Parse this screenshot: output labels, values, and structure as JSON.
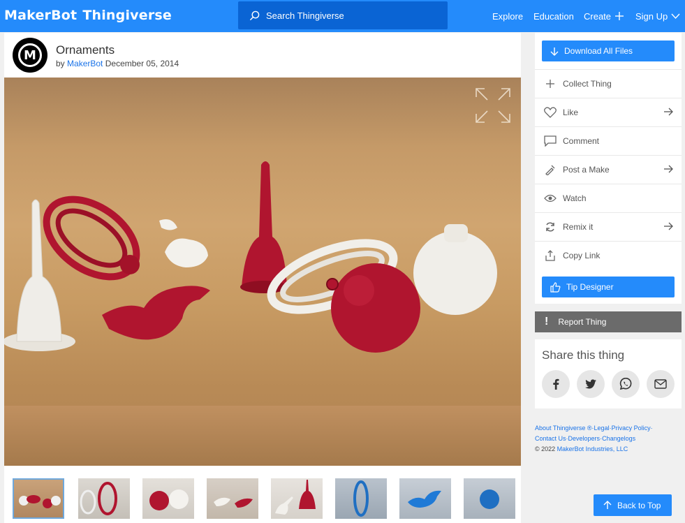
{
  "header": {
    "logo_makerbot": "MakerBot",
    "logo_thingiverse": "Thingiverse",
    "search_placeholder": "Search Thingiverse",
    "nav": {
      "explore": "Explore",
      "education": "Education",
      "create": "Create",
      "signup": "Sign Up"
    }
  },
  "thing": {
    "title": "Ornaments",
    "by_label": "by",
    "author": "MakerBot",
    "date": "December 05, 2014",
    "thumbnail_count": 8,
    "active_thumbnail": 1
  },
  "sidebar": {
    "download": "Download All Files",
    "collect": "Collect Thing",
    "like": "Like",
    "comment": "Comment",
    "post_make": "Post a Make",
    "watch": "Watch",
    "remix": "Remix it",
    "copy_link": "Copy Link",
    "tip": "Tip Designer",
    "report": "Report Thing"
  },
  "share": {
    "title": "Share this thing",
    "icons": [
      "facebook-icon",
      "twitter-icon",
      "whatsapp-icon",
      "email-icon"
    ]
  },
  "footer": {
    "about": "About Thingiverse",
    "reg": "®",
    "legal": "Legal",
    "privacy": "Privacy Policy",
    "contact": "Contact Us",
    "developers": "Developers",
    "changelogs": "Changelogs",
    "sep": "·",
    "copyright": "© 2022",
    "company": "MakerBot Industries, LLC"
  },
  "back_to_top": "Back to Top",
  "colors": {
    "brand_blue": "#248bfb",
    "search_blue": "#0a64d4",
    "report_gray": "#6b6b6b",
    "ornament_red": "#b0152f",
    "ornament_white": "#f1efea"
  }
}
